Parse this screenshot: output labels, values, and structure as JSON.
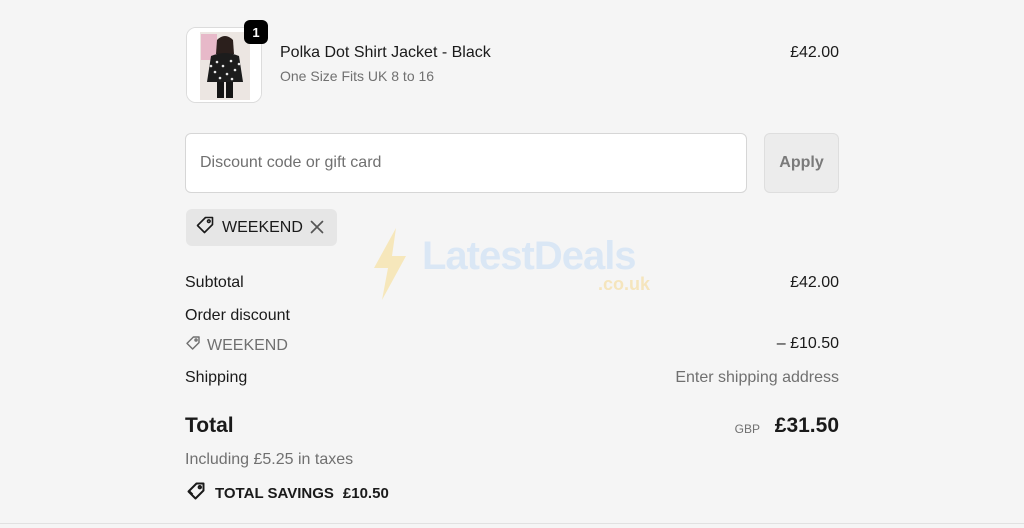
{
  "cart": {
    "item": {
      "title": "Polka Dot Shirt Jacket - Black",
      "variant": "One Size Fits UK 8 to 16",
      "price": "£42.00",
      "quantity": "1"
    }
  },
  "discount": {
    "placeholder": "Discount code or gift card",
    "apply_label": "Apply",
    "applied_code": "WEEKEND"
  },
  "summary": {
    "subtotal_label": "Subtotal",
    "subtotal_value": "£42.00",
    "order_discount_label": "Order discount",
    "discount_code": "WEEKEND",
    "discount_value": "– £10.50",
    "shipping_label": "Shipping",
    "shipping_value": "Enter shipping address",
    "total_label": "Total",
    "total_currency": "GBP",
    "total_value": "£31.50",
    "taxes_note": "Including £5.25 in taxes",
    "savings_label": "TOTAL SAVINGS",
    "savings_value": "£10.50"
  },
  "watermark": {
    "brand": "LatestDeals",
    "suffix": ".co.uk"
  },
  "icons": [
    "tag-icon",
    "close-icon",
    "bolt-icon"
  ]
}
